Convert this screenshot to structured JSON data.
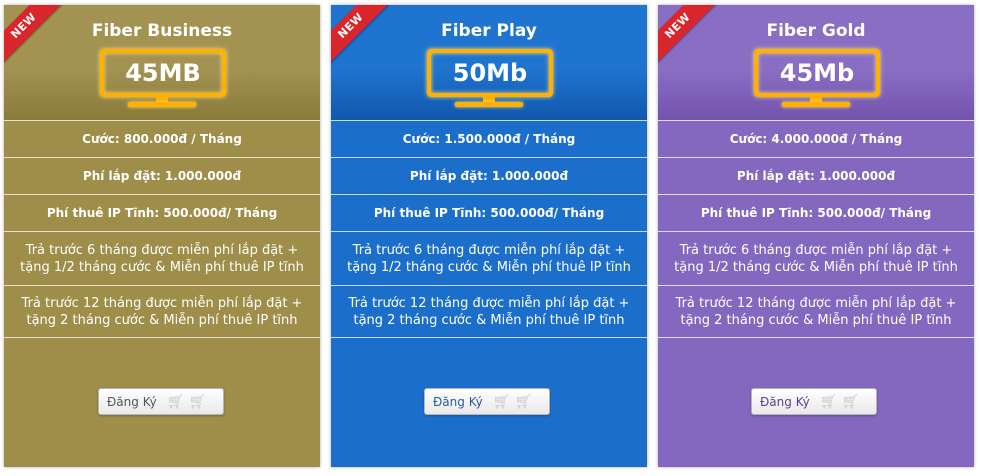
{
  "plans": [
    {
      "badge": "NEW",
      "title": "Fiber Business",
      "speed": "45MB",
      "fee": "Cước: 800.000đ / Tháng",
      "install": "Phí lắp đặt: 1.000.000đ",
      "ip": "Phí thuê IP Tĩnh: 500.000đ/ Tháng",
      "promo6": "Trả trước 6 tháng được miễn phí lắp đặt + tặng 1/2 tháng cước & Miễn phí thuê IP tĩnh",
      "promo12": "Trả trước 12 tháng được miễn phí lắp đặt + tặng 2 tháng cước & Miễn phí thuê IP tĩnh",
      "button": "Đăng Ký"
    },
    {
      "badge": "NEW",
      "title": "Fiber Play",
      "speed": "50Mb",
      "fee": "Cước: 1.500.000đ / Tháng",
      "install": "Phí lắp đặt: 1.000.000đ",
      "ip": "Phí thuê IP Tĩnh: 500.000đ/ Tháng",
      "promo6": "Trả trước 6 tháng được miễn phí lắp đặt + tặng 1/2 tháng cước & Miễn phí thuê IP tĩnh",
      "promo12": "Trả trước 12 tháng được miễn phí lắp đặt + tặng 2 tháng cước & Miễn phí thuê IP tĩnh",
      "button": "Đăng Ký"
    },
    {
      "badge": "NEW",
      "title": "Fiber Gold",
      "speed": "45Mb",
      "fee": "Cước: 4.000.000đ / Tháng",
      "install": "Phí lắp đặt: 1.000.000đ",
      "ip": "Phí thuê IP Tĩnh: 500.000đ/ Tháng",
      "promo6": "Trả trước 6 tháng được miễn phí lắp đặt + tặng 1/2 tháng cước & Miễn phí thuê IP tĩnh",
      "promo12": "Trả trước 12 tháng được miễn phí lắp đặt + tặng 2 tháng cước & Miễn phí thuê IP tĩnh",
      "button": "Đăng Ký"
    }
  ],
  "colors": {
    "gold": "#9e8e4a",
    "blue": "#1b6fcb",
    "purple": "#8468bf",
    "ribbon": "#d9262c",
    "tv_outline": "#ffb000"
  },
  "icons": {
    "cart": "cart-icon",
    "tv": "tv-icon"
  }
}
